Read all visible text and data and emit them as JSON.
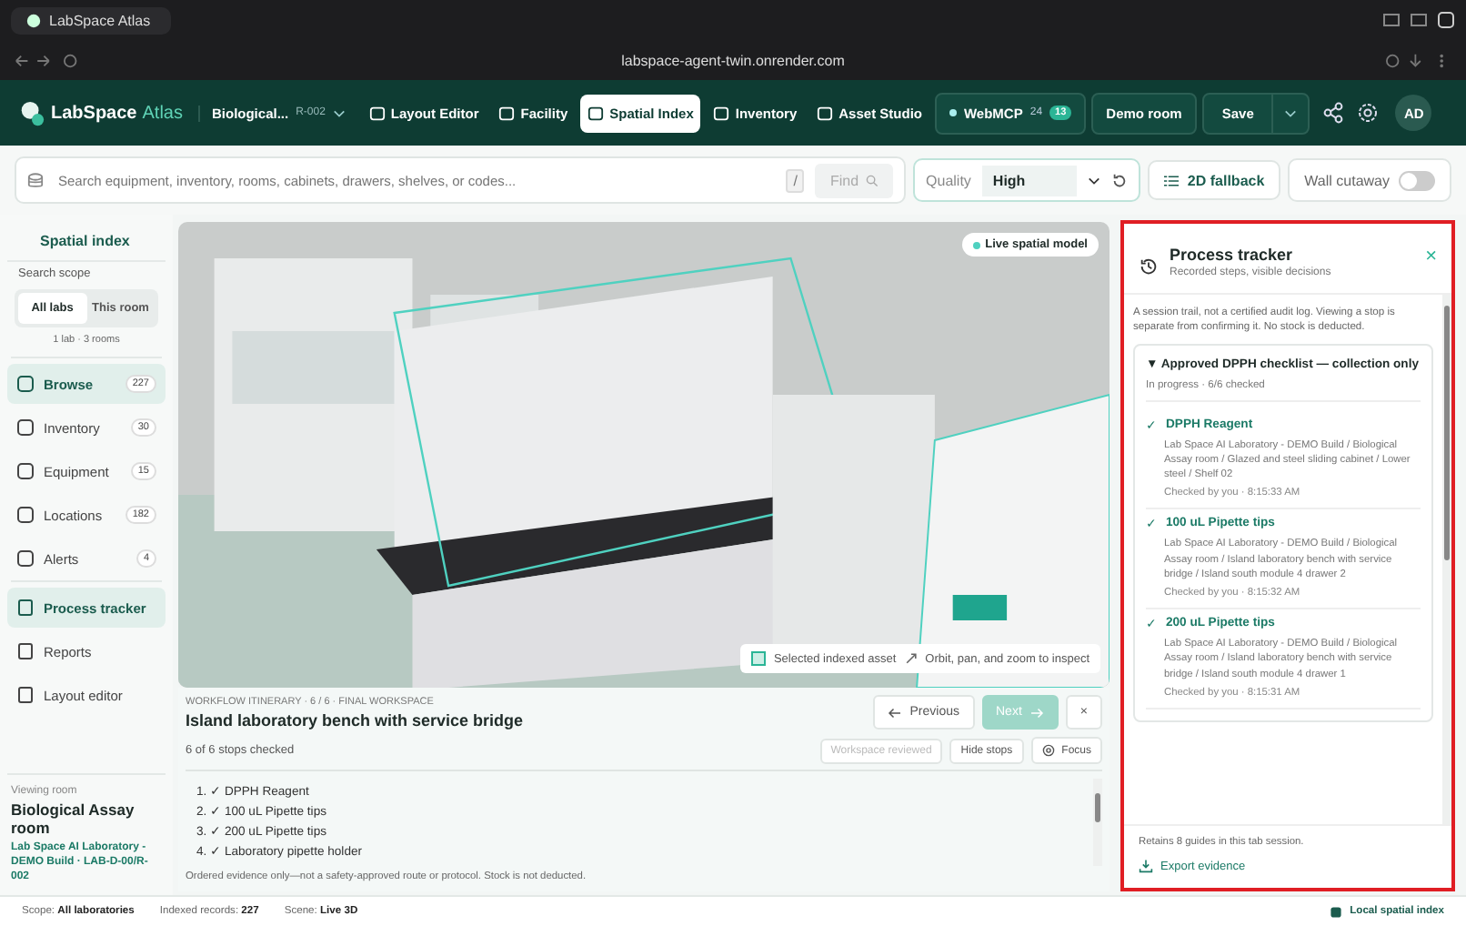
{
  "browser": {
    "tab_title": "LabSpace Atlas",
    "address": "labspace-agent-twin.onrender.com"
  },
  "header": {
    "brand": {
      "name": "LabSpace",
      "accent": "Atlas"
    },
    "room_selector": {
      "name": "Biological...",
      "code": "R-002"
    },
    "nav": [
      {
        "label": "Layout Editor",
        "selected": false
      },
      {
        "label": "Facility",
        "selected": false
      },
      {
        "label": "Spatial Index",
        "selected": true
      },
      {
        "label": "Inventory",
        "selected": false
      },
      {
        "label": "Asset Studio",
        "selected": false
      }
    ],
    "webmcp": {
      "label": "WebMCP",
      "count": "24",
      "badge": "13"
    },
    "demo_room": "Demo room",
    "save": "Save",
    "avatar": "AD"
  },
  "search": {
    "placeholder": "Search equipment, inventory, rooms, cabinets, drawers, shelves, or codes...",
    "shortcut": "/",
    "find": "Find"
  },
  "toolbar": {
    "quality": {
      "label": "Quality",
      "value": "High"
    },
    "fallback": "2D fallback",
    "wall_cutaway": {
      "label": "Wall cutaway",
      "on": false
    }
  },
  "sidebar": {
    "title": "Spatial index",
    "scope_label": "Search scope",
    "scope": [
      {
        "label": "All labs",
        "selected": true
      },
      {
        "label": "This room",
        "selected": false
      }
    ],
    "scope_summary": "1 lab · 3 rooms",
    "nav": [
      {
        "label": "Browse",
        "count": "227",
        "selected": true
      },
      {
        "label": "Inventory",
        "count": "30",
        "selected": false
      },
      {
        "label": "Equipment",
        "count": "15",
        "selected": false
      },
      {
        "label": "Locations",
        "count": "182",
        "selected": false
      },
      {
        "label": "Alerts",
        "count": "4",
        "selected": false
      }
    ],
    "tools": [
      {
        "label": "Process tracker",
        "selected": true
      },
      {
        "label": "Reports",
        "selected": false
      },
      {
        "label": "Layout editor",
        "selected": false
      }
    ],
    "viewing": {
      "label": "Viewing room",
      "room": "Biological Assay room",
      "path": "Lab Space AI Laboratory - DEMO Build · LAB-D-00/R-002"
    }
  },
  "viewport": {
    "badge": "Live spatial model",
    "legend": {
      "selected": "Selected indexed asset",
      "hint": "Orbit, pan, and zoom to inspect"
    }
  },
  "workflow": {
    "eyebrow": "WORKFLOW ITINERARY · 6 / 6 · FINAL WORKSPACE",
    "title": "Island laboratory bench with service bridge",
    "progress": "6 of 6 stops checked",
    "previous": "Previous",
    "next": {
      "label": "Next",
      "disabled": true
    },
    "close": "×",
    "reviewed": {
      "label": "Workspace reviewed",
      "disabled": true
    },
    "hide_stops": "Hide stops",
    "focus": "Focus",
    "stops": [
      "1. ✓ DPPH Reagent",
      "2. ✓ 100 uL Pipette tips",
      "3. ✓ 200 uL Pipette tips",
      "4. ✓ Laboratory pipette holder"
    ],
    "note": "Ordered evidence only—not a safety-approved route or protocol. Stock is not deducted."
  },
  "tracker": {
    "title": "Process tracker",
    "subtitle": "Recorded steps, visible decisions",
    "close": "×",
    "note": "A session trail, not a certified audit log. Viewing a stop is separate from confirming it. No stock is deducted.",
    "checklist": {
      "toggle_glyph": "▼",
      "title": "Approved DPPH checklist — collection only",
      "status": "In progress · 6/6 checked",
      "entries": [
        {
          "mark": "✓",
          "name": "DPPH Reagent",
          "path": "Lab Space AI Laboratory - DEMO Build / Biological Assay room / Glazed and steel sliding cabinet / Lower steel / Shelf 02",
          "checked": "Checked by you · 8:15:33 AM"
        },
        {
          "mark": "✓",
          "name": "100 uL Pipette tips",
          "path": "Lab Space AI Laboratory - DEMO Build / Biological Assay room / Island laboratory bench with service bridge / Island south module 4 drawer 2",
          "checked": "Checked by you · 8:15:32 AM"
        },
        {
          "mark": "✓",
          "name": "200 uL Pipette tips",
          "path": "Lab Space AI Laboratory - DEMO Build / Biological Assay room / Island laboratory bench with service bridge / Island south module 4 drawer 1",
          "checked": "Checked by you · 8:15:31 AM"
        }
      ]
    },
    "footer": "Retains 8 guides in this tab session.",
    "export": "Export evidence"
  },
  "status_bar": {
    "items": [
      {
        "label": "Scope:",
        "value": "All laboratories"
      },
      {
        "label": "Indexed records:",
        "value": "227"
      },
      {
        "label": "Scene:",
        "value": "Live 3D"
      }
    ],
    "right": "Local spatial index"
  }
}
